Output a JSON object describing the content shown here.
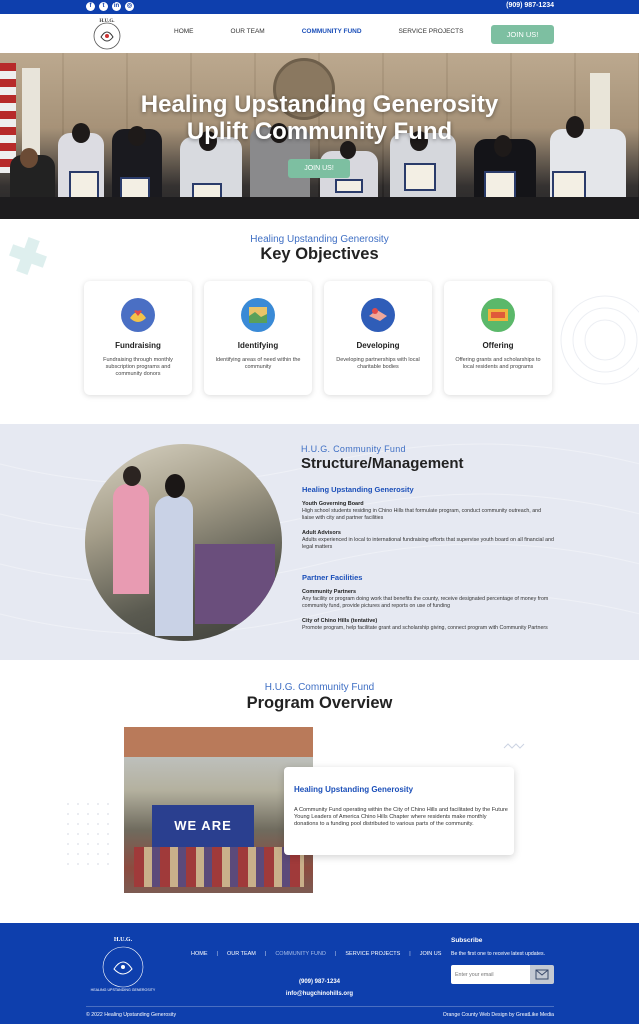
{
  "topbar": {
    "social_icons": [
      "facebook-icon",
      "twitter-icon",
      "linkedin-icon",
      "instagram-icon"
    ],
    "phone": "(909) 987-1234"
  },
  "header": {
    "logo_text": "H.U.G.",
    "nav": [
      "HOME",
      "OUR TEAM",
      "COMMUNITY FUND",
      "SERVICE PROJECTS"
    ],
    "active_nav": "COMMUNITY FUND",
    "join_label": "JOIN US!"
  },
  "hero": {
    "title_line1": "Healing Upstanding Generosity",
    "title_line2": "Uplift Community Fund",
    "button_label": "JOIN US!"
  },
  "objectives": {
    "subtitle": "Healing Upstanding Generosity",
    "title": "Key Objectives",
    "cards": [
      {
        "title": "Fundraising",
        "text": "Fundraising through monthly subscription programs and community donors",
        "icon": "hands-heart-icon"
      },
      {
        "title": "Identifying",
        "text": "Identifying areas of need within the community",
        "icon": "map-icon"
      },
      {
        "title": "Developing",
        "text": "Developing partnerships with local charitable bodies",
        "icon": "handshake-icon"
      },
      {
        "title": "Offering",
        "text": "Offering grants and scholarships to local residents and programs",
        "icon": "money-icon"
      }
    ]
  },
  "structure": {
    "subtitle": "H.U.G. Community Fund",
    "title": "Structure/Management",
    "group1_title": "Healing Upstanding Generosity",
    "youth_h": "Youth Governing Board",
    "youth_p": "High school students residing in Chino Hills that formulate program, conduct community outreach, and liaise with city and partner facilities",
    "adult_h": "Adult Advisors",
    "adult_p": "Adults experienced in local to international fundraising efforts that supervise youth board on all financial and legal matters",
    "group2_title": "Partner Facilities",
    "partners_h": "Community Partners",
    "partners_p": "Any facility or program doing work that benefits the county, receive designated percentage of money from community fund, provide pictures and reports on use of funding",
    "city_h": "City of Chino Hills (tentative)",
    "city_p": "Promote program, help facilitate grant and scholarship giving, connect program with Community Partners"
  },
  "overview": {
    "subtitle": "H.U.G. Community Fund",
    "title": "Program Overview",
    "banner_text": "WE ARE H.U.G.",
    "card_title": "Healing Upstanding Generosity",
    "card_text": "A Community Fund operating within the City of Chino Hills and facilitated by the Future Young Leaders of America Chino Hills Chapter where residents make monthly donations to a funding pool distributed to various parts of the community."
  },
  "footer": {
    "logo_text": "H.U.G.",
    "logo_ring": "HEALING UPSTANDING GENEROSITY",
    "nav": [
      "HOME",
      "OUR TEAM",
      "COMMUNITY FUND",
      "SERVICE PROJECTS",
      "JOIN US"
    ],
    "phone": "(909) 987-1234",
    "email": "info@hugchinohills.org",
    "subscribe_title": "Subscribe",
    "subscribe_text": "Be the first one to receive latest updates.",
    "email_placeholder": "Enter your email",
    "copyright": "© 2022 Healing Upstanding Generosity",
    "credit": "Orange County Web Design by GreatLike Media"
  },
  "colors": {
    "brand_blue": "#0e3fad",
    "accent_green": "#7dbfa1",
    "link_blue": "#1b4fb9",
    "sub_blue": "#3f6fc4"
  }
}
